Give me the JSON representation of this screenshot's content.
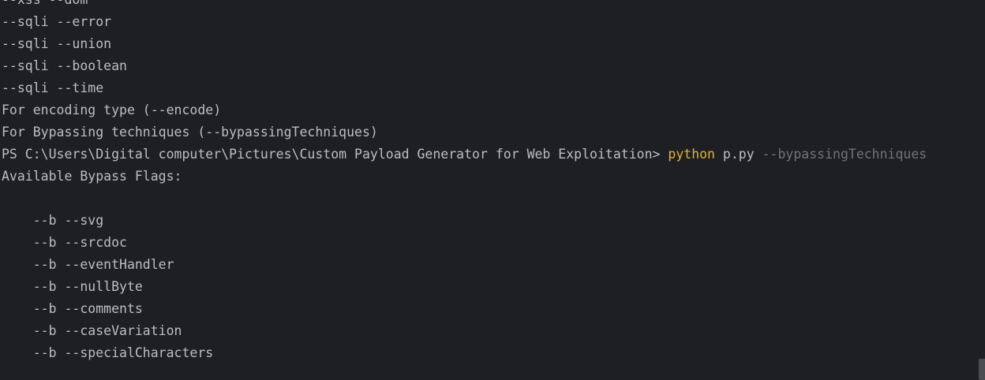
{
  "terminal": {
    "lines_before": [
      "--xss --dom",
      "--sqli --error",
      "--sqli --union",
      "--sqli --boolean",
      "--sqli --time",
      "For encoding type (--encode)",
      "For Bypassing techniques (--bypassingTechniques)"
    ],
    "prompt": {
      "path": "PS C:\\Users\\Digital computer\\Pictures\\Custom Payload Generator for Web Exploitation> ",
      "command": "python",
      "script": " p.py ",
      "argument": "--bypassingTechniques"
    },
    "lines_after": [
      "Available Bypass Flags:",
      "",
      "    --b --svg",
      "    --b --srcdoc",
      "    --b --eventHandler",
      "    --b --nullByte",
      "    --b --comments",
      "    --b --caseVariation",
      "    --b --specialCharacters"
    ]
  },
  "colors": {
    "background": "#1e1f22",
    "text": "#bcbec4",
    "command": "#e0b33a",
    "argument": "#6f737a"
  }
}
